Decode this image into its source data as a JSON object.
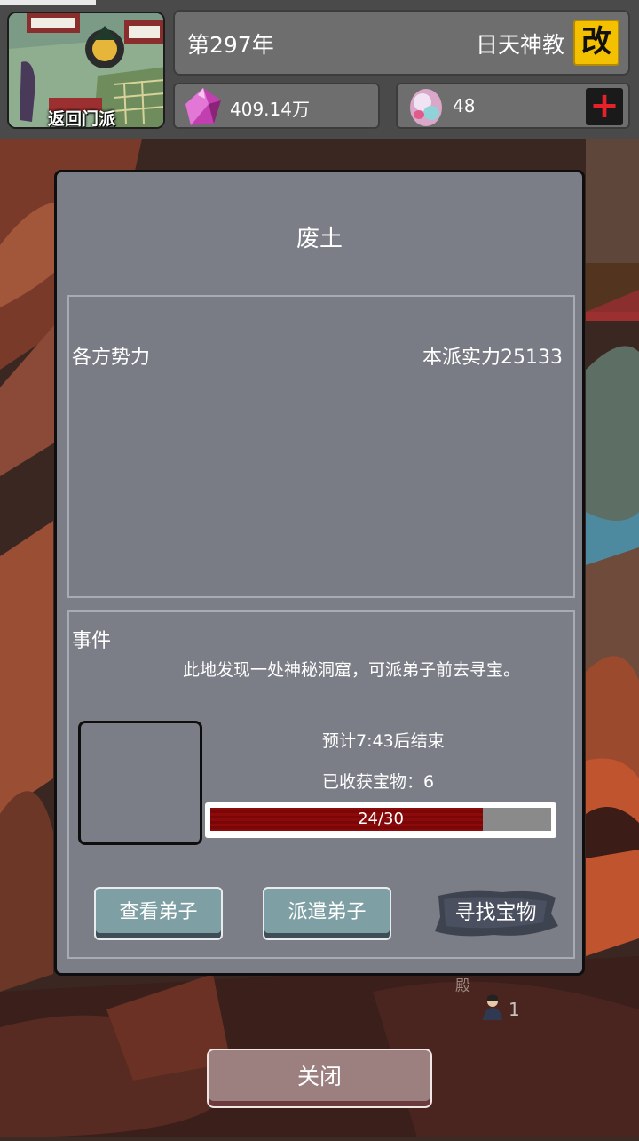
{
  "hud": {
    "return_label": "返回门派",
    "year": "第297年",
    "sect_name": "日天神教",
    "rename_label": "改",
    "crystal_amount": "409.14万",
    "egg_amount": "48",
    "add_label": "+"
  },
  "dialog": {
    "title": "废土",
    "factions_label": "各方势力",
    "sect_power": "本派实力25133",
    "events_label": "事件",
    "event_description": "此地发现一处神秘洞窟，可派弟子前去寻宝。",
    "eta": "预计7:43后结束",
    "treasures_found": "已收获宝物：6",
    "progress": {
      "current": 24,
      "max": 30,
      "text": "24/30"
    },
    "buttons": {
      "view_disciple": "查看弟子",
      "dispatch_disciple": "派遣弟子",
      "find_treasure": "寻找宝物"
    }
  },
  "background": {
    "hall_label": "殿",
    "figure_count": "1"
  },
  "close_label": "关闭",
  "colors": {
    "rename_accent": "#f3c100",
    "progress_fill": "#8e0a0a",
    "add_icon": "#e8202a"
  }
}
